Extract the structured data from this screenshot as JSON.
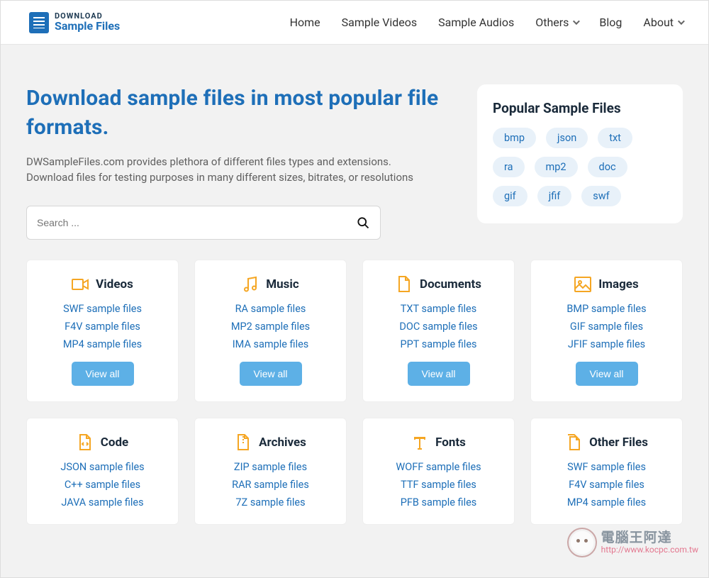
{
  "logo": {
    "line1": "DOWNLOAD",
    "line2": "Sample Files"
  },
  "nav": {
    "home": "Home",
    "videos": "Sample Videos",
    "audios": "Sample Audios",
    "others": "Others",
    "blog": "Blog",
    "about": "About"
  },
  "hero": {
    "title": "Download sample files in most popular file formats.",
    "sub": "DWSampleFiles.com provides plethora of different files types and extensions. Download files for testing purposes in many different sizes, bitrates, or resolutions"
  },
  "search": {
    "placeholder": "Search ..."
  },
  "popular": {
    "title": "Popular Sample Files",
    "tags": [
      "bmp",
      "json",
      "txt",
      "ra",
      "mp2",
      "doc",
      "gif",
      "jfif",
      "swf"
    ]
  },
  "viewall": "View all",
  "cards": [
    {
      "title": "Videos",
      "icon": "video-icon",
      "links": [
        "SWF sample files",
        "F4V sample files",
        "MP4 sample files"
      ]
    },
    {
      "title": "Music",
      "icon": "music-icon",
      "links": [
        "RA sample files",
        "MP2 sample files",
        "IMA sample files"
      ]
    },
    {
      "title": "Documents",
      "icon": "document-icon",
      "links": [
        "TXT sample files",
        "DOC sample files",
        "PPT sample files"
      ]
    },
    {
      "title": "Images",
      "icon": "image-icon",
      "links": [
        "BMP sample files",
        "GIF sample files",
        "JFIF sample files"
      ]
    },
    {
      "title": "Code",
      "icon": "code-icon",
      "links": [
        "JSON sample files",
        "C++ sample files",
        "JAVA sample files"
      ]
    },
    {
      "title": "Archives",
      "icon": "archive-icon",
      "links": [
        "ZIP sample files",
        "RAR sample files",
        "7Z sample files"
      ]
    },
    {
      "title": "Fonts",
      "icon": "font-icon",
      "links": [
        "WOFF sample files",
        "TTF sample files",
        "PFB sample files"
      ]
    },
    {
      "title": "Other Files",
      "icon": "other-icon",
      "links": [
        "SWF sample files",
        "F4V sample files",
        "MP4 sample files"
      ]
    }
  ],
  "watermark": {
    "text": "電腦王阿達",
    "url": "http://www.kocpc.com.tw"
  }
}
